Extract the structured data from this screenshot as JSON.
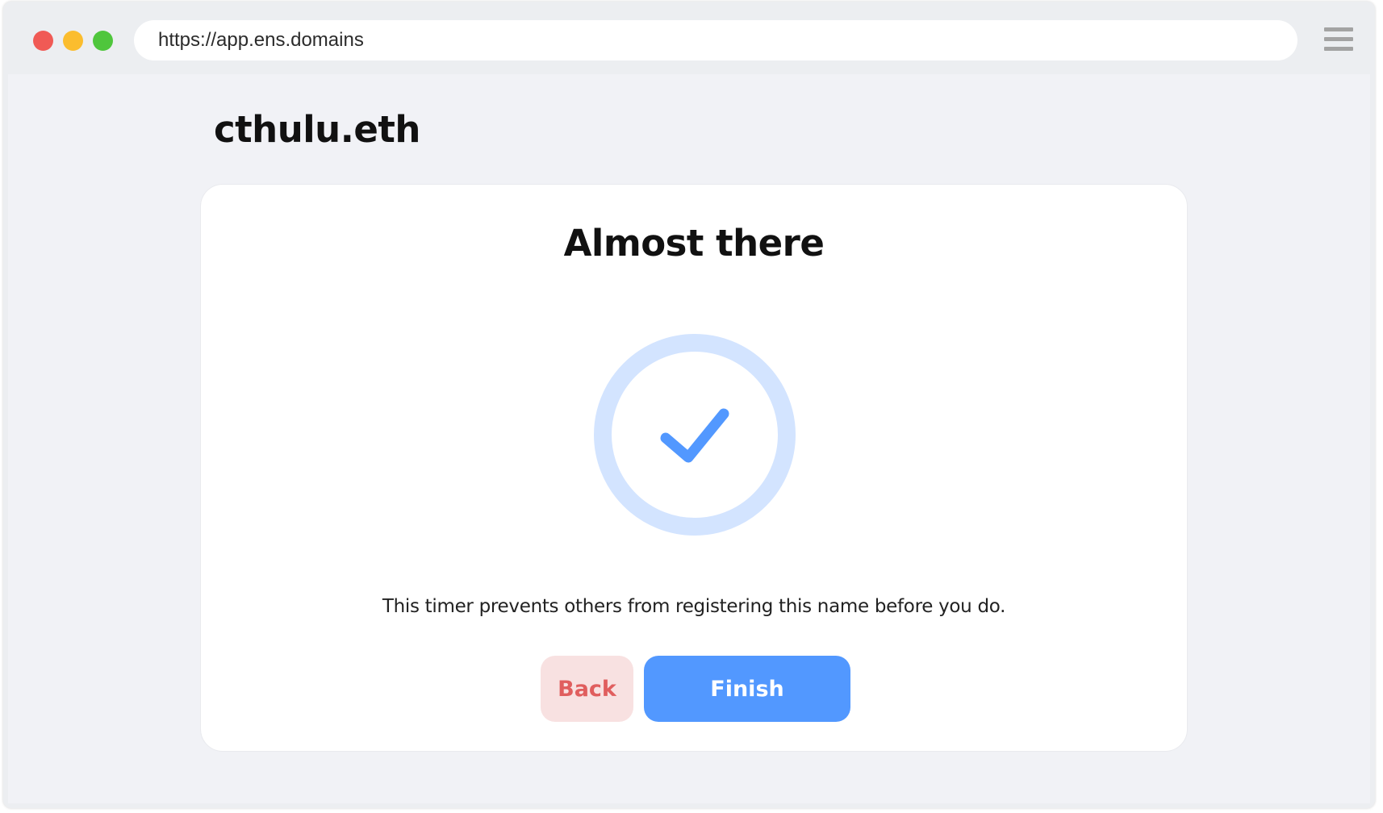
{
  "browser": {
    "url": "https://app.ens.domains"
  },
  "page": {
    "domain_name": "cthulu.eth"
  },
  "card": {
    "title": "Almost there",
    "description": "This timer prevents others from registering this name before you do.",
    "back_label": "Back",
    "finish_label": "Finish"
  },
  "icons": {
    "window_controls": [
      "close-dot-icon",
      "minimize-dot-icon",
      "maximize-dot-icon"
    ],
    "menu": "hamburger-menu-icon",
    "status": "check-circle-icon"
  },
  "colors": {
    "accent": "#5298ff",
    "ring": "#d3e4ff",
    "back_bg": "#f8e1e1",
    "back_text": "#e05e5e"
  }
}
